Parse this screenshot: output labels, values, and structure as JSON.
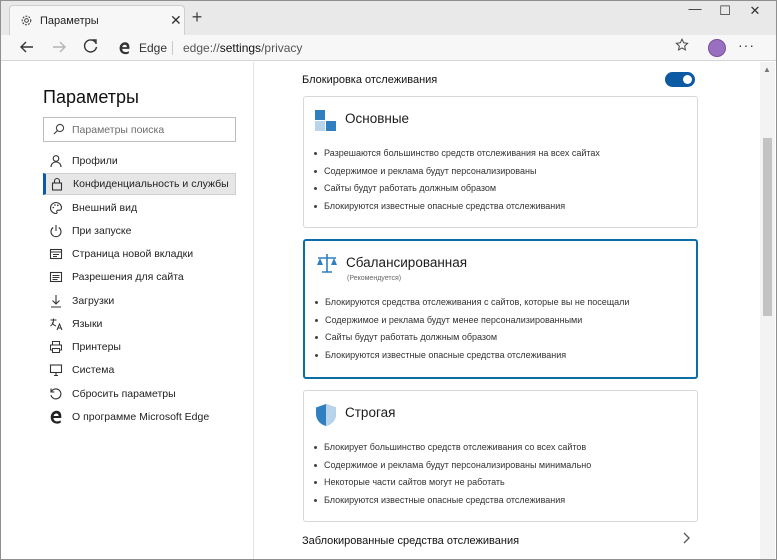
{
  "tab": {
    "title": "Параметры",
    "close": "✕",
    "new": "+"
  },
  "window": {
    "minimize": "—",
    "maximize": "☐",
    "close": "✕"
  },
  "toolbar": {
    "brand": "Edge",
    "url_host": "edge://",
    "url_path_strong": "settings",
    "url_path_rest": "/privacy",
    "more": "···"
  },
  "sidebar": {
    "title": "Параметры",
    "search_placeholder": "Параметры поиска",
    "items": [
      {
        "label": "Профили",
        "icon": "person-icon"
      },
      {
        "label": "Конфиденциальность и службы",
        "icon": "lock-icon",
        "active": true
      },
      {
        "label": "Внешний вид",
        "icon": "palette-icon"
      },
      {
        "label": "При запуске",
        "icon": "power-icon"
      },
      {
        "label": "Страница новой вкладки",
        "icon": "new-tab-icon"
      },
      {
        "label": "Разрешения для сайта",
        "icon": "site-permissions-icon"
      },
      {
        "label": "Загрузки",
        "icon": "download-icon"
      },
      {
        "label": "Языки",
        "icon": "languages-icon"
      },
      {
        "label": "Принтеры",
        "icon": "printer-icon"
      },
      {
        "label": "Система",
        "icon": "system-icon"
      },
      {
        "label": "Сбросить параметры",
        "icon": "reset-icon"
      },
      {
        "label": "О программе Microsoft Edge",
        "icon": "edge-icon"
      }
    ]
  },
  "main": {
    "tracking_label": "Блокировка отслеживания",
    "tracking_enabled": true,
    "cards": [
      {
        "title": "Основные",
        "subtitle": "",
        "selected": false,
        "bullets": [
          "Разрешаются большинство средств отслеживания на всех сайтах",
          "Содержимое и реклама будут персонализированы",
          "Сайты будут работать должным образом",
          "Блокируются известные опасные средства отслеживания"
        ]
      },
      {
        "title": "Сбалансированная",
        "subtitle": "(Рекомендуется)",
        "selected": true,
        "bullets": [
          "Блокируются средства отслеживания с сайтов, которые вы не посещали",
          "Содержимое и реклама будут менее персонализированными",
          "Сайты будут работать должным образом",
          "Блокируются известные опасные средства отслеживания"
        ]
      },
      {
        "title": "Строгая",
        "subtitle": "",
        "selected": false,
        "bullets": [
          "Блокирует большинство средств отслеживания со всех сайтов",
          "Содержимое и реклама будут персонализированы минимально",
          "Некоторые части сайтов могут не работать",
          "Блокируются известные опасные средства отслеживания"
        ]
      }
    ],
    "blocked_label": "Заблокированные средства отслеживания"
  },
  "colors": {
    "accent": "#0c59a4",
    "selected_border": "#0c6ea6"
  }
}
